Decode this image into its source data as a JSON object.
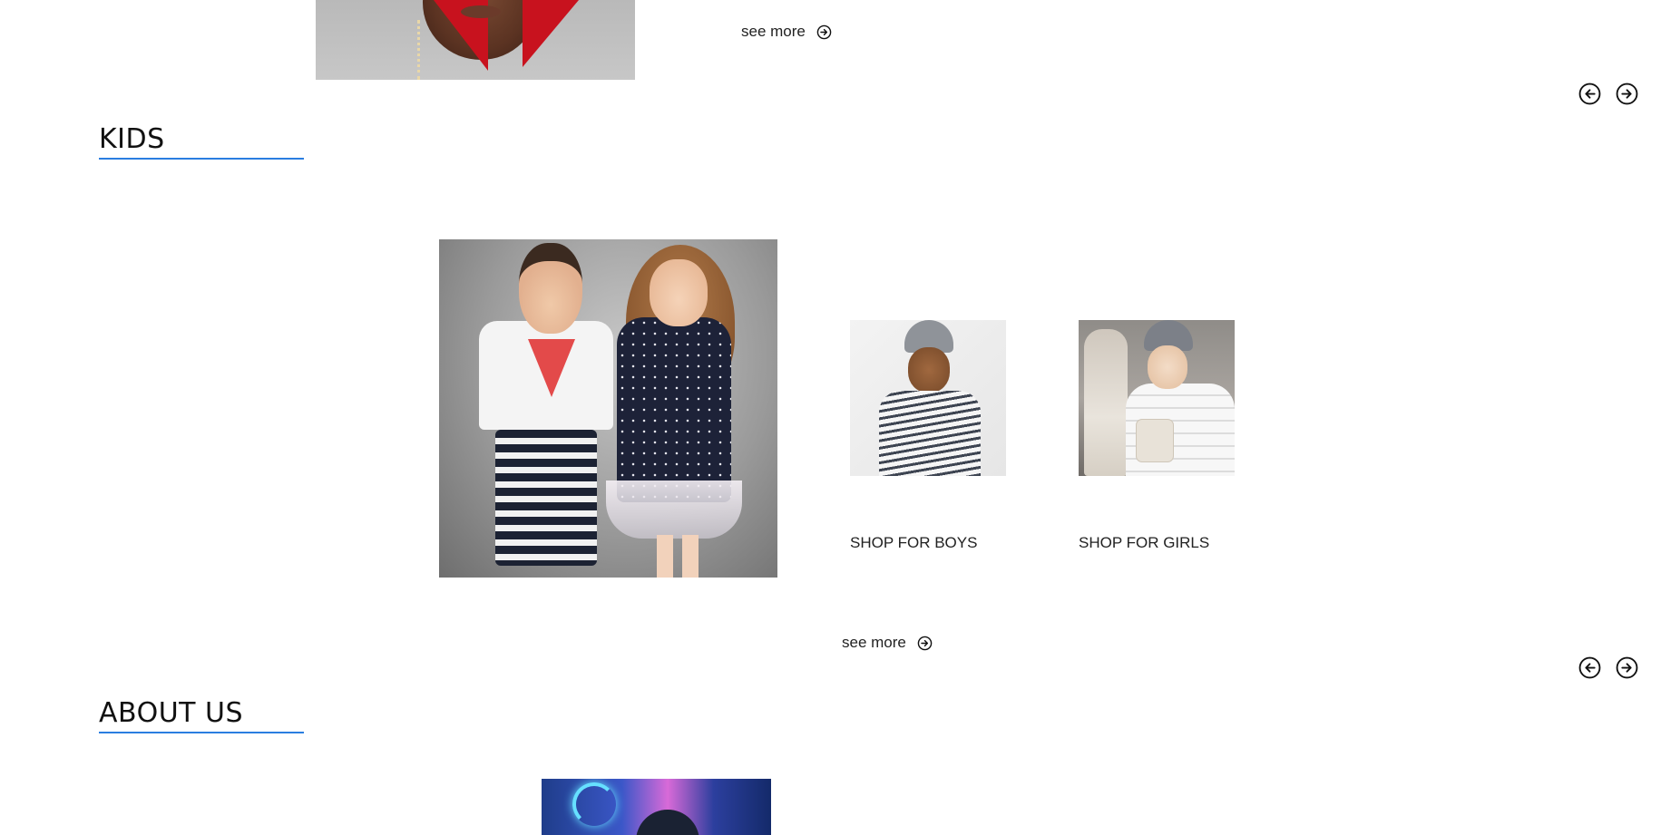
{
  "featured": {
    "see_more_label": "see more"
  },
  "kids": {
    "title": "KIDS",
    "see_more_label": "see more",
    "categories": [
      {
        "label": "SHOP FOR BOYS"
      },
      {
        "label": "SHOP FOR GIRLS"
      }
    ]
  },
  "about": {
    "title": "ABOUT US"
  },
  "icons": {
    "see_more": "arrow-right-circle-icon",
    "prev": "arrow-left-circle-icon",
    "next": "arrow-right-circle-icon"
  },
  "colors": {
    "heading_underline": "#2a7ee0",
    "text": "#222222",
    "background": "#ffffff"
  }
}
